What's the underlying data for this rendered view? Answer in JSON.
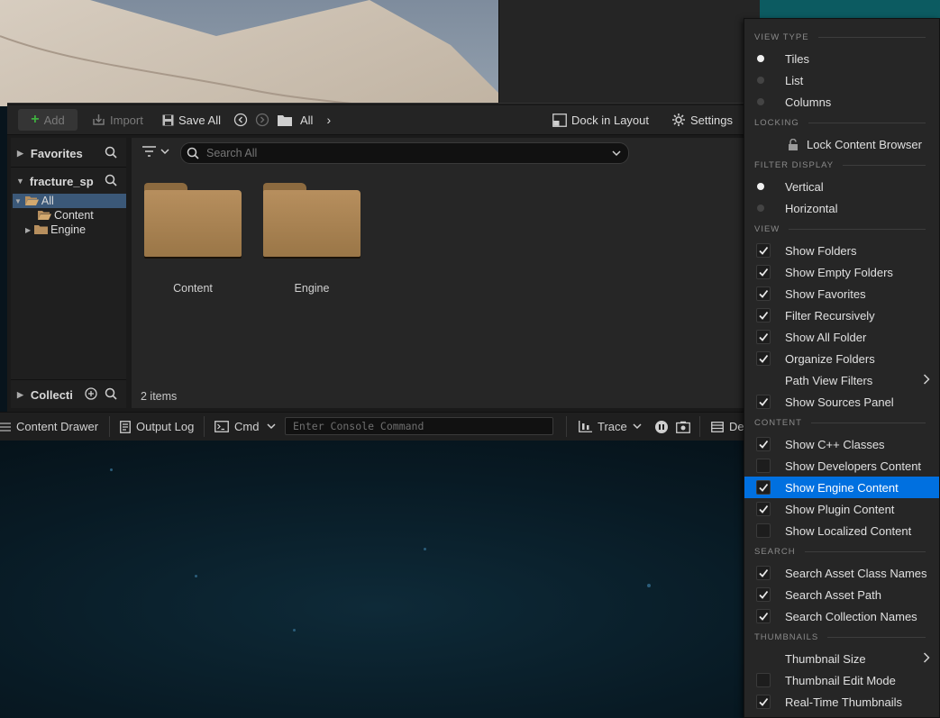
{
  "toolbar": {
    "add": "Add",
    "import": "Import",
    "save_all": "Save All",
    "breadcrumb_all": "All",
    "dock_in_layout": "Dock in Layout",
    "settings": "Settings"
  },
  "sources": {
    "favorites": "Favorites",
    "project": "fracture_sp",
    "collections": "Collecti",
    "tree": [
      {
        "label": "All"
      },
      {
        "label": "Content"
      },
      {
        "label": "Engine"
      }
    ]
  },
  "search": {
    "placeholder": "Search All"
  },
  "folders": [
    {
      "label": "Content"
    },
    {
      "label": "Engine"
    }
  ],
  "status": {
    "items": "2 items"
  },
  "bottom_bar": {
    "content_drawer": "Content Drawer",
    "output_log": "Output Log",
    "cmd": "Cmd",
    "console_placeholder": "Enter Console Command",
    "trace": "Trace",
    "derived": "De"
  },
  "menu": {
    "sections": {
      "view_type": "VIEW TYPE",
      "locking": "LOCKING",
      "filter_display": "FILTER DISPLAY",
      "view": "VIEW",
      "content": "CONTENT",
      "search": "SEARCH",
      "thumbnails": "THUMBNAILS"
    },
    "view_type": [
      {
        "label": "Tiles",
        "selected": true
      },
      {
        "label": "List",
        "selected": false
      },
      {
        "label": "Columns",
        "selected": false
      }
    ],
    "lock_content_browser": "Lock Content Browser",
    "filter_display": [
      {
        "label": "Vertical",
        "selected": true
      },
      {
        "label": "Horizontal",
        "selected": false
      }
    ],
    "view": [
      {
        "label": "Show Folders",
        "checked": true
      },
      {
        "label": "Show Empty Folders",
        "checked": true
      },
      {
        "label": "Show Favorites",
        "checked": true
      },
      {
        "label": "Filter Recursively",
        "checked": true
      },
      {
        "label": "Show All Folder",
        "checked": true
      },
      {
        "label": "Organize Folders",
        "checked": true
      },
      {
        "label": "Path View Filters",
        "submenu": true
      },
      {
        "label": "Show Sources Panel",
        "checked": true
      }
    ],
    "content": [
      {
        "label": "Show C++ Classes",
        "checked": true
      },
      {
        "label": "Show Developers Content",
        "checked": false
      },
      {
        "label": "Show Engine Content",
        "checked": true,
        "highlighted": true
      },
      {
        "label": "Show Plugin Content",
        "checked": true
      },
      {
        "label": "Show Localized Content",
        "checked": false
      }
    ],
    "search": [
      {
        "label": "Search Asset Class Names",
        "checked": true
      },
      {
        "label": "Search Asset Path",
        "checked": true
      },
      {
        "label": "Search Collection Names",
        "checked": true
      }
    ],
    "thumbnails": [
      {
        "label": "Thumbnail Size",
        "submenu": true
      },
      {
        "label": "Thumbnail Edit Mode",
        "checked": false
      },
      {
        "label": "Real-Time Thumbnails",
        "checked": true
      }
    ]
  },
  "colors": {
    "highlight": "#0070e0",
    "folder": "#b78f5e",
    "selection": "#3b5878"
  }
}
